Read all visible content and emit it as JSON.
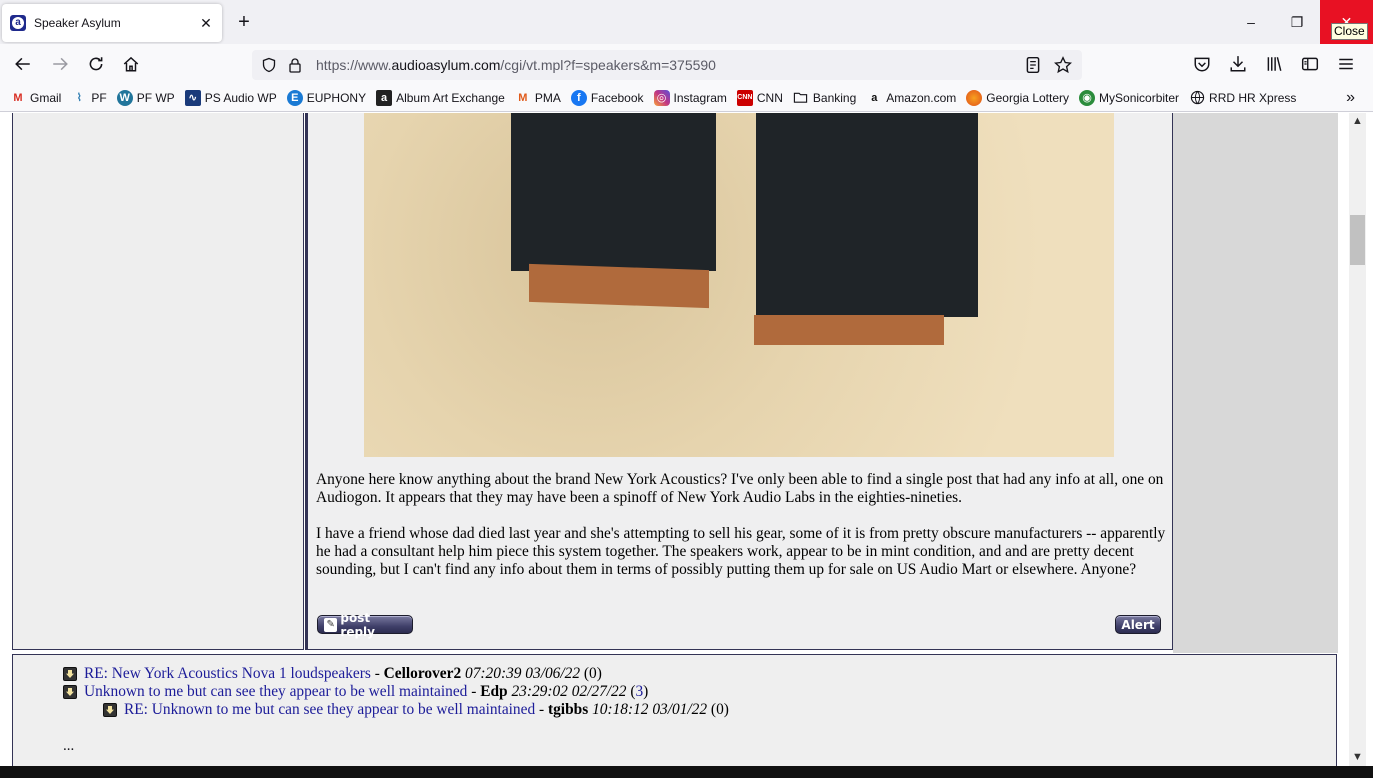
{
  "browser": {
    "tab": {
      "title": "Speaker Asylum",
      "favicon": "audioasylum-a-icon"
    },
    "new_tab_label": "+",
    "window_controls": {
      "minimize": "–",
      "restore": "❐",
      "close": "✕",
      "close_tooltip": "Close"
    },
    "url": {
      "prefix": "https://www.",
      "domain": "audioasylum.com",
      "path": "/cgi/vt.mpl?f=speakers&m=375590"
    },
    "bookmarks": [
      {
        "label": "Gmail",
        "icon": "gmail-icon",
        "glyph": "M",
        "color": "#d93025"
      },
      {
        "label": "PF",
        "icon": "pf-waveform-icon",
        "glyph": "⌇",
        "color": "#2a7ab0"
      },
      {
        "label": "PF WP",
        "icon": "wordpress-icon",
        "glyph": "W",
        "color": "#21759b"
      },
      {
        "label": "PS Audio WP",
        "icon": "ps-audio-icon",
        "glyph": "∿",
        "color": "#1a3a7a"
      },
      {
        "label": "EUPHONY",
        "icon": "euphony-icon",
        "glyph": "E",
        "color": "#1a7ad4"
      },
      {
        "label": "Album Art Exchange",
        "icon": "album-art-icon",
        "glyph": "a",
        "color": "#222222"
      },
      {
        "label": "PMA",
        "icon": "pma-icon",
        "glyph": "M",
        "color": "#e05a1a"
      },
      {
        "label": "Facebook",
        "icon": "facebook-icon",
        "glyph": "f",
        "color": "#1877f2"
      },
      {
        "label": "Instagram",
        "icon": "instagram-icon",
        "glyph": "◎",
        "color": "#c13584"
      },
      {
        "label": "CNN",
        "icon": "cnn-icon",
        "glyph": "C",
        "color": "#cc0000"
      },
      {
        "label": "Banking",
        "icon": "folder-icon",
        "glyph": "🗀",
        "color": "#ffffff"
      },
      {
        "label": "Amazon.com",
        "icon": "amazon-icon",
        "glyph": "a",
        "color": "#ffffff"
      },
      {
        "label": "Georgia Lottery",
        "icon": "georgia-lottery-icon",
        "glyph": "●",
        "color": "#ffffff"
      },
      {
        "label": "MySonicorbiter",
        "icon": "sonicorbiter-icon",
        "glyph": "◉",
        "color": "#ffffff"
      },
      {
        "label": "RRD HR Xpress",
        "icon": "globe-icon",
        "glyph": "⊕",
        "color": "#ffffff"
      }
    ],
    "bookmarks_overflow": "»"
  },
  "post": {
    "paragraphs": [
      "Anyone here know anything about the brand New York Acoustics? I've only been able to find a single post that had any info at all, one on Audiogon. It appears that they may have been a spinoff of New York Audio Labs in the eighties-nineties.",
      "I have a friend whose dad died last year and she's attempting to sell his gear, some of it is from pretty obscure manufacturers -- apparently he had a consultant help him piece this system together. The speakers work, appear to be in mint condition, and and are pretty decent sounding, but I can't find any info about them in terms of possibly putting them up for sale on US Audio Mart or elsewhere. Anyone?"
    ],
    "image_alt": "Two tower speakers with black grilles and wood bases on beige carpet",
    "reply_button": "post reply",
    "alert_button": "Alert"
  },
  "thread": {
    "replies": [
      {
        "title": "RE: New York Acoustics Nova 1 loudspeakers",
        "author": "Cellorover2",
        "time": "07:20:39 03/06/22",
        "count_open": "(",
        "count": "0",
        "count_close": ")",
        "indent": 0
      },
      {
        "title": "Unknown to me but can see they appear to be well maintained",
        "author": "Edp",
        "time": "23:29:02 02/27/22",
        "count_open": "(",
        "count": "3",
        "count_close": ")",
        "indent": 0
      },
      {
        "title": "RE: Unknown to me but can see they appear to be well maintained",
        "author": "tgibbs",
        "time": "10:18:12 03/01/22",
        "count_open": "(",
        "count": "0",
        "count_close": ")",
        "indent": 1
      }
    ],
    "separator": " - ",
    "more": "..."
  }
}
